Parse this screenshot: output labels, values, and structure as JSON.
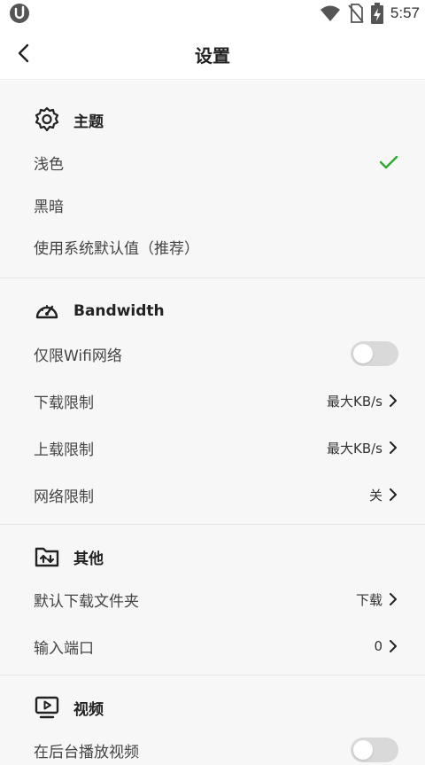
{
  "status_bar": {
    "time": "5:57"
  },
  "header": {
    "title": "设置"
  },
  "sections": {
    "theme": {
      "title": "主题",
      "options": [
        "浅色",
        "黑暗",
        "使用系统默认值（推荐）"
      ],
      "selected_index": 0
    },
    "bandwidth": {
      "title": "Bandwidth",
      "wifi_only": {
        "label": "仅限Wifi网络",
        "enabled": false
      },
      "download_limit": {
        "label": "下载限制",
        "value": "最大KB/s"
      },
      "upload_limit": {
        "label": "上载限制",
        "value": "最大KB/s"
      },
      "network_limit": {
        "label": "网络限制",
        "value": "关"
      }
    },
    "other": {
      "title": "其他",
      "download_folder": {
        "label": "默认下载文件夹",
        "value": "下载"
      },
      "input_port": {
        "label": "输入端口",
        "value": "0"
      }
    },
    "video": {
      "title": "视频",
      "background_play": {
        "label": "在后台播放视频",
        "enabled": false
      }
    }
  },
  "colors": {
    "accent_check": "#2eaa2e",
    "toggle_off": "#d9d9d9",
    "background": "#f7f7f7"
  }
}
